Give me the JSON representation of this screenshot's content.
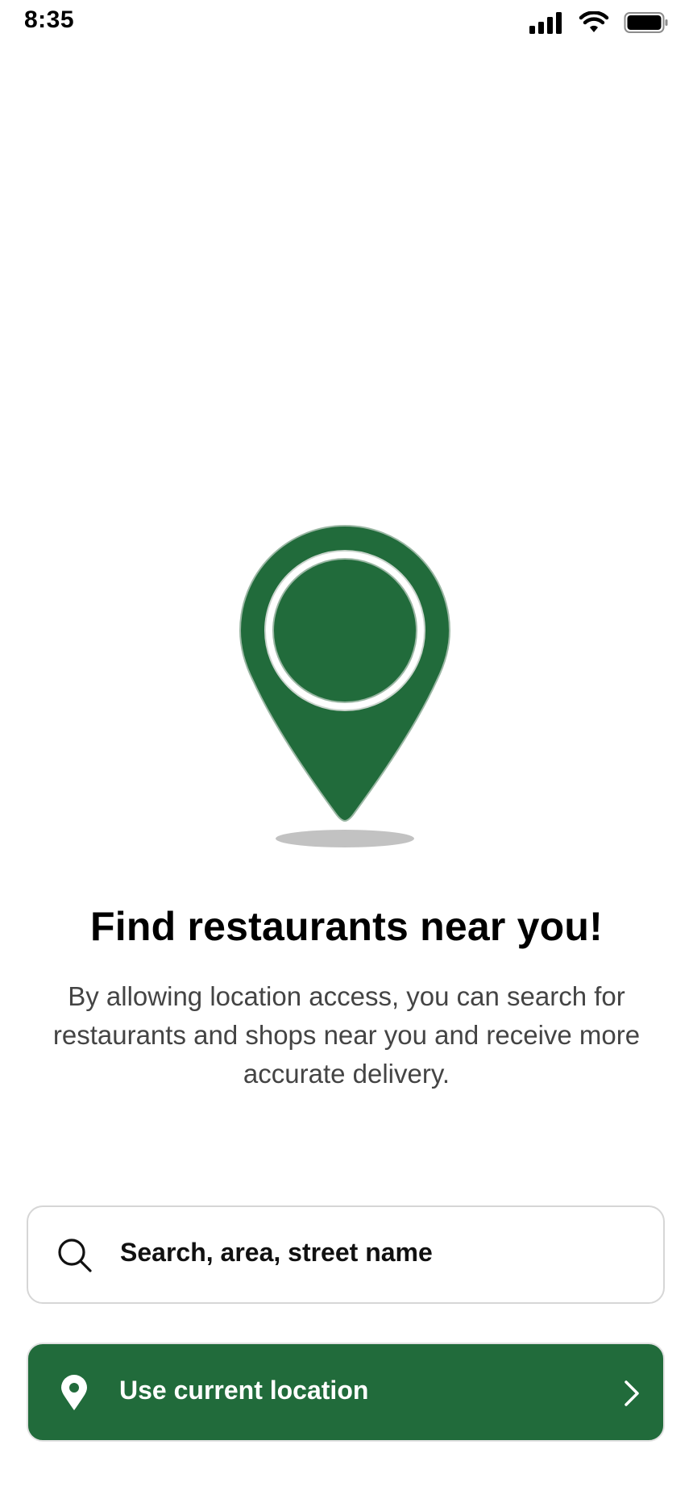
{
  "status_bar": {
    "time": "8:35"
  },
  "main": {
    "title": "Find restaurants near you!",
    "description": "By allowing location access, you can search for restaurants and shops near you and receive more accurate delivery."
  },
  "search": {
    "placeholder": "Search, area, street name",
    "icon": "search-icon"
  },
  "location_button": {
    "label": "Use current location",
    "icon": "map-pin-icon",
    "trailing_icon": "chevron-right-icon"
  },
  "colors": {
    "brand_green": "#216b3b",
    "border": "#d6d6d6",
    "text_secondary": "#444444"
  }
}
